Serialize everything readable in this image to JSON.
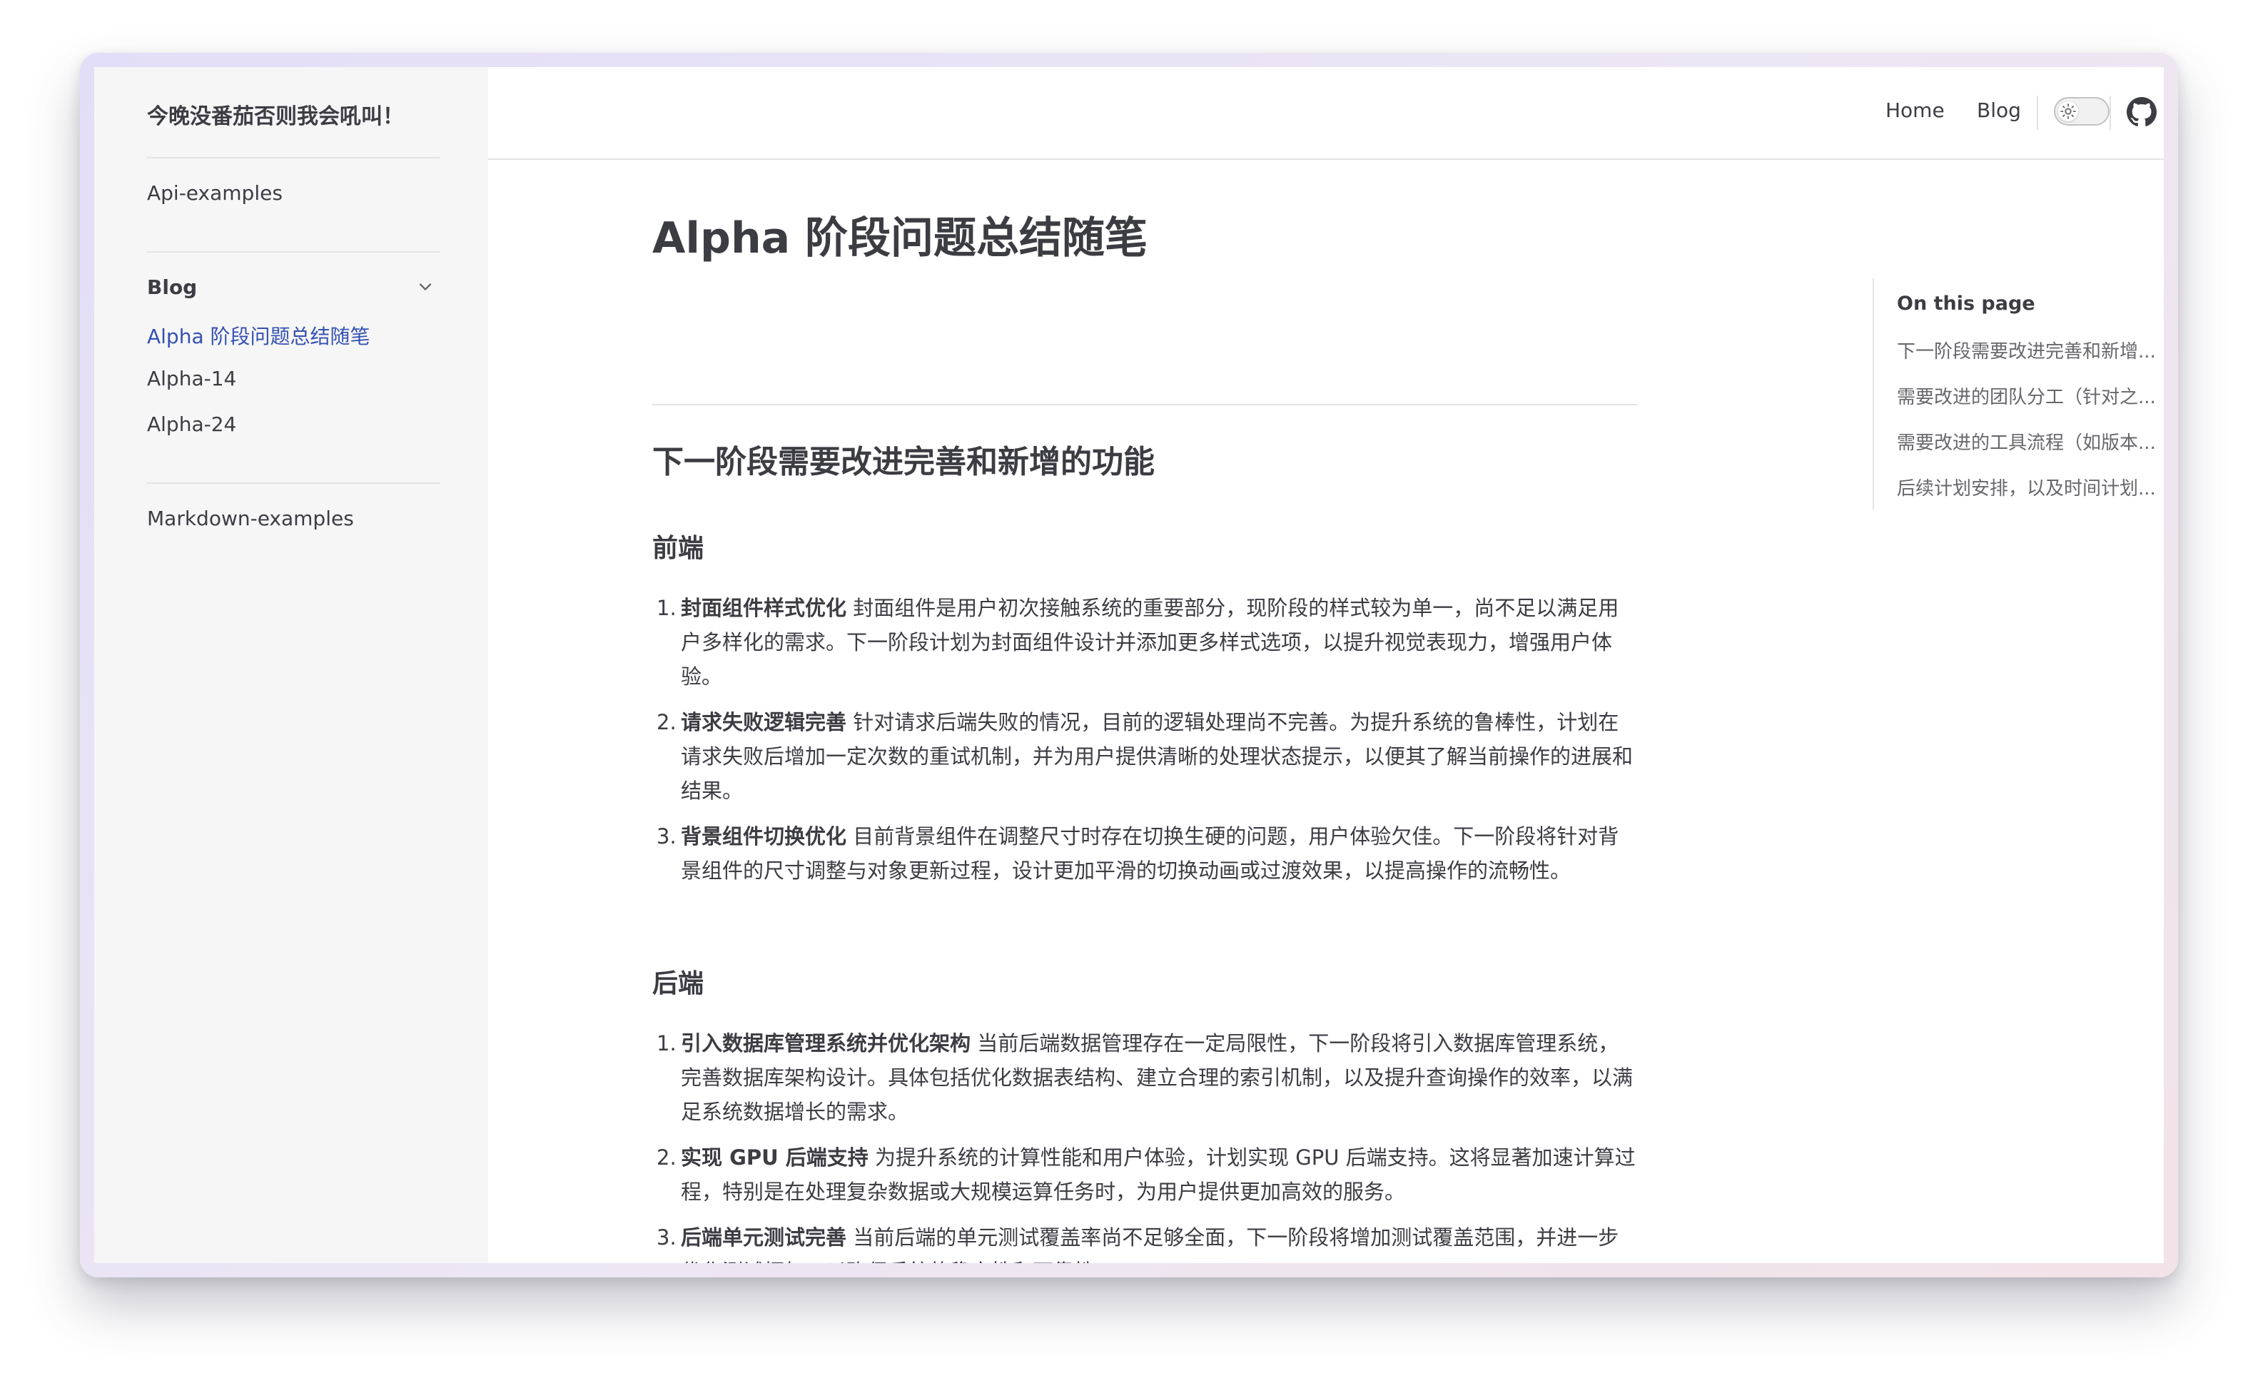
{
  "site": {
    "title": "今晚没番茄否则我会吼叫！"
  },
  "sidebar": {
    "top_item": "Api-examples",
    "group_title": "Blog",
    "group_items": [
      "Alpha 阶段问题总结随笔",
      "Alpha-14",
      "Alpha-24"
    ],
    "bottom_item": "Markdown-examples"
  },
  "nav": {
    "home": "Home",
    "blog": "Blog"
  },
  "outline": {
    "title": "On this page",
    "items": [
      "下一阶段需要改进完善和新增...",
      "需要改进的团队分工（针对之...",
      "需要改进的工具流程（如版本...",
      "后续计划安排，以及时间计划..."
    ]
  },
  "article": {
    "title": "Alpha 阶段问题总结随笔",
    "section1_heading": "下一阶段需要改进完善和新增的功能",
    "frontend": {
      "heading": "前端",
      "items": [
        {
          "num": "1.",
          "title": "封面组件样式优化",
          "text": "封面组件是用户初次接触系统的重要部分，现阶段的样式较为单一，尚不足以满足用户多样化的需求。下一阶段计划为封面组件设计并添加更多样式选项，以提升视觉表现力，增强用户体验。"
        },
        {
          "num": "2.",
          "title": "请求失败逻辑完善",
          "text": "针对请求后端失败的情况，目前的逻辑处理尚不完善。为提升系统的鲁棒性，计划在请求失败后增加一定次数的重试机制，并为用户提供清晰的处理状态提示，以便其了解当前操作的进展和结果。"
        },
        {
          "num": "3.",
          "title": "背景组件切换优化",
          "text": "目前背景组件在调整尺寸时存在切换生硬的问题，用户体验欠佳。下一阶段将针对背景组件的尺寸调整与对象更新过程，设计更加平滑的切换动画或过渡效果，以提高操作的流畅性。"
        }
      ]
    },
    "backend": {
      "heading": "后端",
      "items": [
        {
          "num": "1.",
          "title": "引入数据库管理系统并优化架构",
          "text": "当前后端数据管理存在一定局限性，下一阶段将引入数据库管理系统，完善数据库架构设计。具体包括优化数据表结构、建立合理的索引机制，以及提升查询操作的效率，以满足系统数据增长的需求。"
        },
        {
          "num": "2.",
          "title": "实现 GPU 后端支持",
          "text": "为提升系统的计算性能和用户体验，计划实现 GPU 后端支持。这将显著加速计算过程，特别是在处理复杂数据或大规模运算任务时，为用户提供更加高效的服务。"
        },
        {
          "num": "3.",
          "title": "后端单元测试完善",
          "text": "当前后端的单元测试覆盖率尚不足够全面，下一阶段将增加测试覆盖范围，并进一步优化测试框架，以确保系统的稳定性和可靠性。"
        }
      ]
    }
  }
}
